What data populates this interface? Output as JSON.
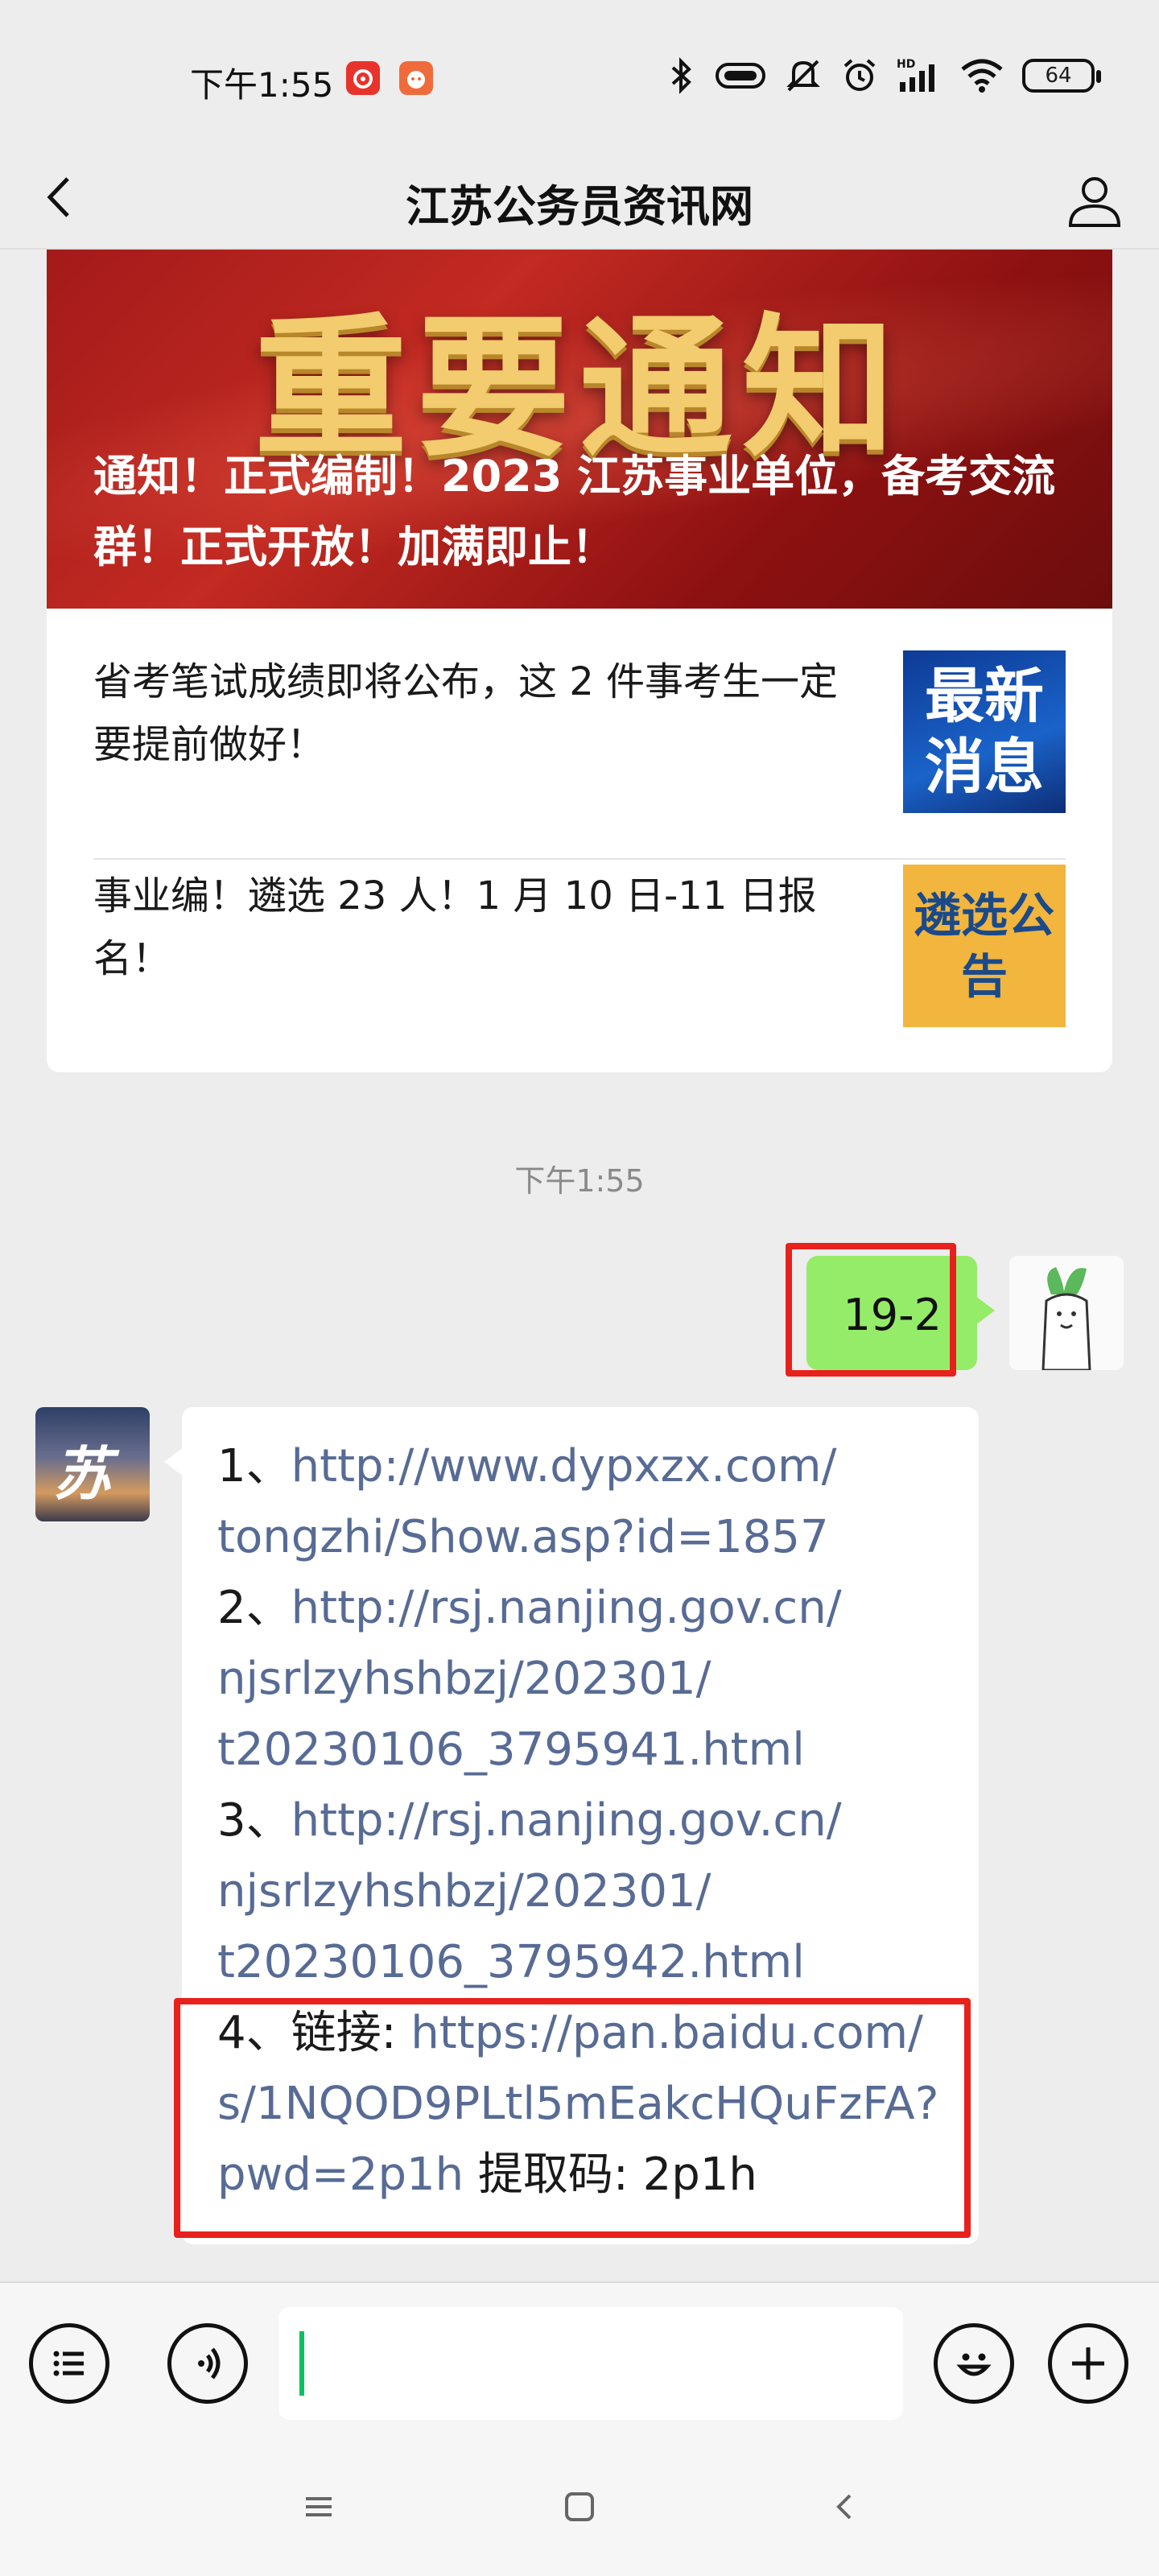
{
  "status_bar": {
    "time": "下午1:55",
    "battery": "64",
    "icons": [
      "netease-music-icon",
      "app-notification-icon",
      "bluetooth-icon",
      "nfc-icon",
      "mute-icon",
      "alarm-icon",
      "hd-signal-icon",
      "wifi-icon",
      "battery-icon"
    ]
  },
  "header": {
    "title": "江苏公务员资讯网"
  },
  "article_card": {
    "banner_headline": "重要通知",
    "banner_caption": "通知！正式编制！2023 江苏事业单位，备考交流群！正式开放！加满即止！",
    "items": [
      {
        "text": "省考笔试成绩即将公布，这 2 件事考生一定要提前做好！",
        "thumb_text": "最新消息"
      },
      {
        "text": "事业编！遴选 23 人！1 月 10 日-11 日报名！",
        "thumb_text": "遴选公告"
      }
    ]
  },
  "chat": {
    "timestamp": "下午1:55",
    "sent_message": "19-2",
    "reply": {
      "line_1_prefix": "1、",
      "line_1_link": "http://www.dypxzx.com/",
      "line_2_link": "tongzhi/Show.asp?id=1857",
      "line_3_prefix": "2、",
      "line_3_link": "http://rsj.nanjing.gov.cn/",
      "line_4_link": "njsrlzyhshbzj/202301/",
      "line_5_link": "t20230106_3795941.html",
      "line_6_prefix": "3、",
      "line_6_link": "http://rsj.nanjing.gov.cn/",
      "line_7_link": "njsrlzyhshbzj/202301/",
      "line_8_link": "t20230106_3795942.html",
      "line_9_prefix": "4、链接: ",
      "line_9_link": "https://pan.baidu.com/",
      "line_10_link": "s/1NQOD9PLtl5mEakcHQuFzFA?",
      "line_11_link": "pwd=2p1h",
      "line_11_suffix": " 提取码: 2p1h"
    }
  },
  "input_bar": {
    "value": ""
  },
  "colors": {
    "sent_bubble": "#95ec69",
    "link": "#576b95",
    "highlight_border": "#e8211c",
    "background": "#ededed"
  }
}
